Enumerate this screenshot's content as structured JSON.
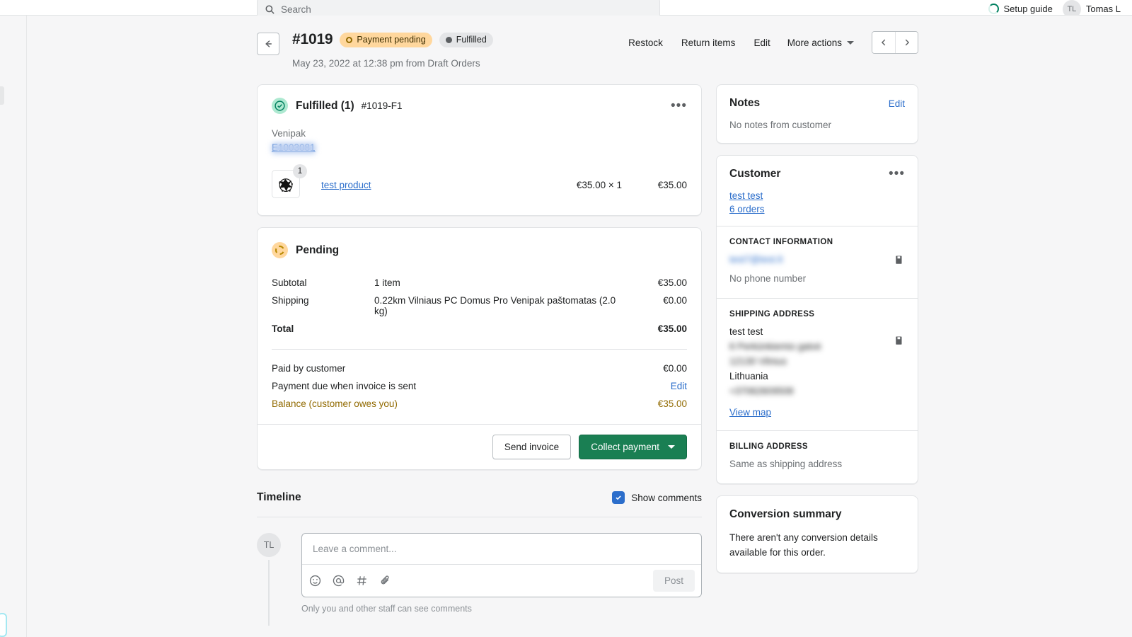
{
  "topbar": {
    "search_placeholder": "Search",
    "setup_guide_label": "Setup guide",
    "user_initials": "TL",
    "user_name": "Tomas L"
  },
  "order": {
    "number": "#1019",
    "badges": [
      {
        "label": "Payment pending",
        "style": "warn"
      },
      {
        "label": "Fulfilled",
        "style": "info"
      }
    ],
    "subtitle": "May 23, 2022 at 12:38 pm from Draft Orders",
    "actions": {
      "restock": "Restock",
      "return_items": "Return items",
      "edit": "Edit",
      "more_actions": "More actions"
    }
  },
  "fulfillment": {
    "title": "Fulfilled (1)",
    "id": "#1019-F1",
    "carrier": "Venipak",
    "tracking_number": "E1003081",
    "line_item": {
      "name": "test product",
      "quantity": "1",
      "unit_price": "€35.00 × 1",
      "total": "€35.00"
    }
  },
  "payment": {
    "status_title": "Pending",
    "rows": [
      {
        "label": "Subtotal",
        "detail": "1 item",
        "amount": "€35.00",
        "bold": false
      },
      {
        "label": "Shipping",
        "detail": "0.22km Vilniaus PC Domus Pro Venipak paštomatas (2.0 kg)",
        "amount": "€0.00",
        "bold": false
      },
      {
        "label": "Total",
        "detail": "",
        "amount": "€35.00",
        "bold": true
      }
    ],
    "paid_label": "Paid by customer",
    "paid_amount": "€0.00",
    "due_label": "Payment due when invoice is sent",
    "due_edit": "Edit",
    "balance_label": "Balance (customer owes you)",
    "balance_amount": "€35.00",
    "send_invoice_label": "Send invoice",
    "collect_payment_label": "Collect payment"
  },
  "timeline": {
    "title": "Timeline",
    "show_comments_label": "Show comments",
    "avatar_initials": "TL",
    "comment_placeholder": "Leave a comment...",
    "post_label": "Post",
    "note": "Only you and other staff can see comments"
  },
  "sidebar": {
    "notes": {
      "title": "Notes",
      "edit_label": "Edit",
      "empty_text": "No notes from customer"
    },
    "customer": {
      "title": "Customer",
      "name": "test test",
      "orders": "6 orders",
      "contact_heading": "CONTACT INFORMATION",
      "email": "test7@test.lt",
      "phone": "No phone number",
      "shipping_heading": "SHIPPING ADDRESS",
      "shipping_name": "test test",
      "shipping_street": "6 Perkūnkiemio gatvė",
      "shipping_city": "12130 Vilnius",
      "shipping_country": "Lithuania",
      "shipping_phone": "+37062609508",
      "view_map_label": "View map",
      "billing_heading": "BILLING ADDRESS",
      "billing_text": "Same as shipping address"
    },
    "conversion": {
      "title": "Conversion summary",
      "empty_text": "There aren't any conversion details available for this order."
    }
  }
}
